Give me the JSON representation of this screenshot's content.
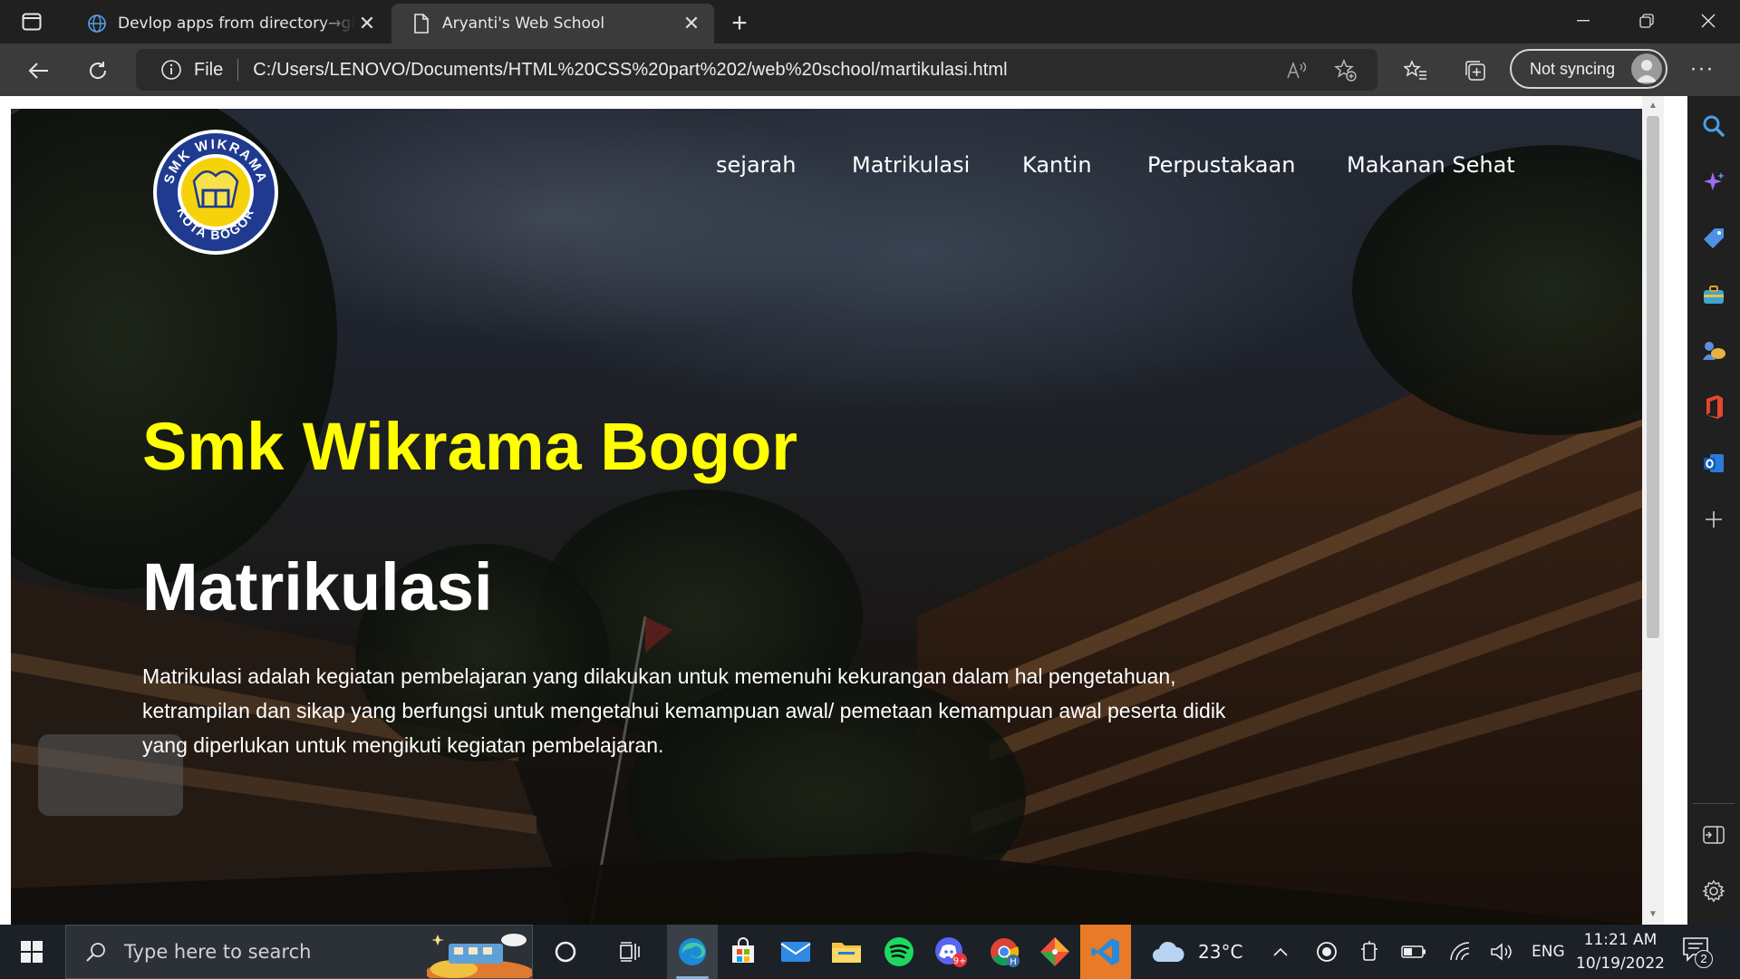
{
  "browser": {
    "tabs": [
      {
        "title": "Devlop apps from directory→github",
        "active": false,
        "icon": "globe-icon"
      },
      {
        "title": "Aryanti's Web School",
        "active": true,
        "icon": "page-icon"
      }
    ],
    "address_bar": {
      "scheme": "File",
      "url": "C:/Users/LENOVO/Documents/HTML%20CSS%20part%202/web%20school/martikulasi.html"
    },
    "profile_button": {
      "label": "Not syncing"
    }
  },
  "page": {
    "logo": {
      "text_top": "SMK WIKRAMA",
      "text_bottom": "KOTA BOGOR"
    },
    "nav": [
      {
        "label": "sejarah"
      },
      {
        "label": "Matrikulasi"
      },
      {
        "label": "Kantin"
      },
      {
        "label": "Perpustakaan"
      },
      {
        "label": "Makanan Sehat"
      }
    ],
    "school_title": "Smk Wikrama Bogor",
    "heading": "Matrikulasi",
    "description": "Matrikulasi adalah kegiatan pembelajaran yang dilakukan untuk memenuhi kekurangan dalam hal pengetahuan, ketrampilan dan sikap yang berfungsi untuk mengetahui kemampuan awal/ pemetaan kemampuan awal peserta didik yang diperlukan untuk mengikuti kegiatan pembelajaran.",
    "colors": {
      "title": "#ffff00",
      "text": "#ffffff"
    }
  },
  "taskbar": {
    "search_placeholder": "Type here to search",
    "weather": {
      "temperature": "23°C"
    },
    "language": "ENG",
    "clock": {
      "time": "11:21 AM",
      "date": "10/19/2022"
    },
    "notifications": {
      "count": "2"
    },
    "apps": [
      "edge-icon",
      "store-icon",
      "mail-icon",
      "file-explorer-icon",
      "spotify-icon",
      "discord-icon",
      "chrome-icon",
      "git-icon",
      "vscode-icon"
    ],
    "app_badges": {
      "discord": "9+"
    }
  }
}
